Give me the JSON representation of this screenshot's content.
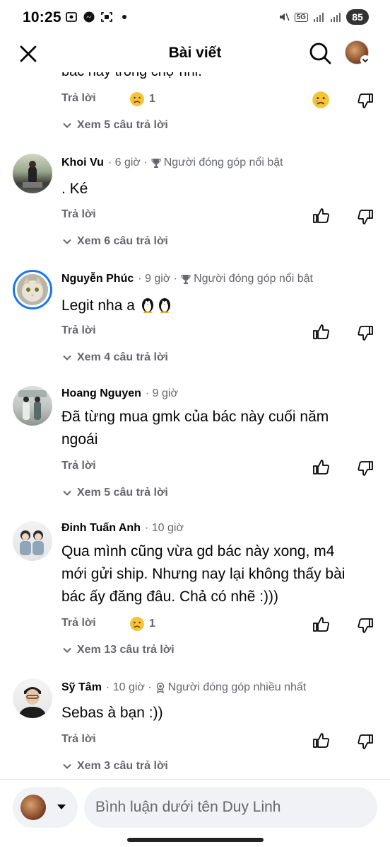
{
  "status_bar": {
    "time": "10:25",
    "battery": "85",
    "network": "5G"
  },
  "header": {
    "title": "Bài viết",
    "close_icon": "close-icon",
    "search_icon": "search-icon"
  },
  "feed": {
    "cut_off_text": "bác này trong chợ nhỉ.",
    "reply_label": "Trả lời",
    "top_actions": {
      "reaction_count": "1",
      "see_replies": "Xem 5 câu trả lời"
    },
    "comments": [
      {
        "author": "Khoi Vu",
        "time": "6 giờ",
        "badge": "Người đóng góp nổi bật",
        "badge_icon": "trophy-icon",
        "text": ". Ké",
        "see_replies": "Xem 6 câu trả lời"
      },
      {
        "author": "Nguyễn Phúc",
        "time": "9 giờ",
        "badge": "Người đóng góp nổi bật",
        "badge_icon": "trophy-icon",
        "text": "Legit nha a",
        "emoji": "penguin-emoji",
        "see_replies": "Xem 4 câu trả lời"
      },
      {
        "author": "Hoang Nguyen",
        "time": "9 giờ",
        "text_line1": "Đã từng mua gmk của bác này cuối năm",
        "text_line2": "ngoái",
        "see_replies": "Xem 5 câu trả lời"
      },
      {
        "author": "Đinh Tuấn Anh",
        "time": "10 giờ",
        "text_line1": "Qua mình cũng vừa gd bác này xong, m4",
        "text_line2": "mới gửi ship. Nhưng nay lại không thấy bài",
        "text_line3": "bác ấy đăng đâu. Chả có nhẽ :)))",
        "reaction_count": "1",
        "see_replies": "Xem 13 câu trả lời"
      },
      {
        "author": "Sỹ Tâm",
        "time": "10 giờ",
        "badge": "Người đóng góp nhiều nhất",
        "badge_icon": "rising-contributor-icon",
        "text": "Sebas à bạn :))",
        "see_replies": "Xem 3 câu trả lời"
      }
    ]
  },
  "composer": {
    "placeholder": "Bình luận dưới tên Duy Linh"
  },
  "colors": {
    "text_primary": "#050505",
    "text_secondary": "#65676b",
    "input_bg": "#f0f2f5",
    "story_ring": "#1877f2"
  }
}
